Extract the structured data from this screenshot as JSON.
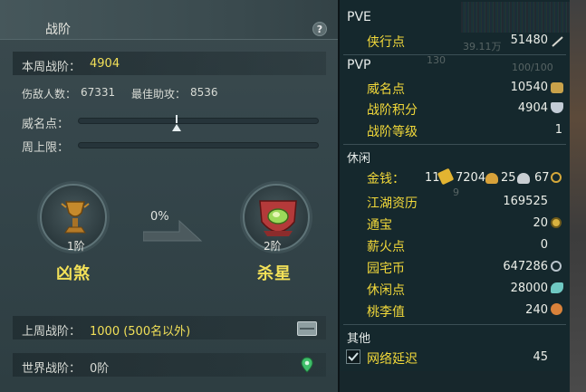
{
  "left": {
    "tab_title": "战阶",
    "help": "?",
    "week_rank_label": "本周战阶：",
    "week_rank_value": "4904",
    "kills_label": "伤敌人数：",
    "kills_value": "67331",
    "assist_label": "最佳助攻：",
    "assist_value": "8536",
    "prestige_label": "威名点：",
    "prestige_progress": 0.41,
    "weekly_cap_label": "周上限：",
    "weekly_cap_progress": 0,
    "current_rank": {
      "level": "1阶",
      "name": "凶煞"
    },
    "progress_pct": "0%",
    "next_rank": {
      "level": "2阶",
      "name": "杀星"
    },
    "last_week_label": "上周战阶：",
    "last_week_value": "1000 (500名以外)",
    "world_label": "世界战阶：",
    "world_value": "0阶"
  },
  "right": {
    "pve_title": "PVE",
    "pve_items": [
      {
        "label": "侠行点",
        "value": "51480"
      }
    ],
    "pvp_title": "PVP",
    "pvp_items": [
      {
        "label": "威名点",
        "value": "10540"
      },
      {
        "label": "战阶积分",
        "value": "4904"
      },
      {
        "label": "战阶等级",
        "value": "1"
      }
    ],
    "leisure_title": "休闲",
    "money_label": "金钱：",
    "money_gold_bars": "11",
    "money_gold": "7204",
    "money_silver": "25",
    "money_copper": "67",
    "leisure_items": [
      {
        "label": "江湖资历",
        "value": "169525"
      },
      {
        "label": "通宝",
        "value": "20"
      },
      {
        "label": "薪火点",
        "value": "0"
      },
      {
        "label": "园宅币",
        "value": "647286"
      },
      {
        "label": "休闲点",
        "value": "28000"
      },
      {
        "label": "桃李值",
        "value": "240"
      }
    ],
    "other_title": "其他",
    "latency_label": "网络延迟",
    "latency_value": "45",
    "background_texts": {
      "wan": "39.11万",
      "num130": "130",
      "hp": "100/100",
      "n9": "9"
    }
  },
  "colors": {
    "label_yellow": "#f2d93a",
    "value_yellow": "#f2e058"
  }
}
